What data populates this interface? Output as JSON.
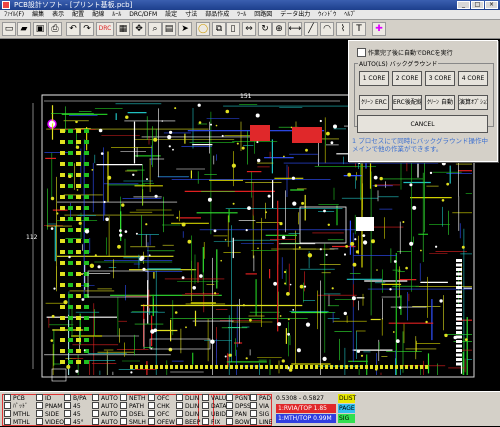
{
  "window": {
    "title": "PCB設計ソフト - [プリント基板.pcb]",
    "minimize": "_",
    "maximize": "□",
    "close": "×"
  },
  "menu": [
    "ﾌｧｲﾙ(F)",
    "編集",
    "表示",
    "配置",
    "配線",
    "ﾙｰﾙ",
    "DRC/DFM",
    "設定",
    "寸法",
    "部品作成",
    "ﾂｰﾙ",
    "回路図",
    "データ出力",
    "ｳｨﾝﾄﾞｳ",
    "ﾍﾙﾌﾟ"
  ],
  "toolbar": {
    "icons": [
      "new-file-icon",
      "open-folder-icon",
      "save-icon",
      "print-icon",
      "undo-icon",
      "redo-icon",
      "drc-icon",
      "grid-icon",
      "pan-icon",
      "zoom-icon",
      "layer-icon",
      "select-icon",
      "circle-icon",
      "copy-icon",
      "paste-icon",
      "move-icon",
      "rotate-icon",
      "pin-icon",
      "measure-icon",
      "line-icon",
      "arc-icon",
      "wire-icon",
      "text-icon",
      "cross-icon"
    ],
    "drc_label": "DRC"
  },
  "board": {
    "dimension_top": "151",
    "dimension_left": "112"
  },
  "dialog": {
    "checkbox_label": "作業完了後に自動でDRCを実行",
    "group_label": "AUTO(LS) バックグラウンド",
    "core_buttons": [
      "1 CORE",
      "2 CORE",
      "3 CORE",
      "4 CORE"
    ],
    "mode_buttons": [
      "ｸﾘｰﾝ ERC",
      "ERC後配線",
      "ｸﾘｰﾝ 自動",
      "演算ｵﾌﾟｼｮﾝ"
    ],
    "cancel_label": "CANCEL",
    "info_text": "1 プロセスにて同時にバックグラウンド操作中\nメインで他の作業ができます。"
  },
  "status": {
    "col1": [
      "PCB",
      "ﾊﾟｯﾄﾞ",
      "MTHL",
      "MTHL"
    ],
    "col2": [
      "ID",
      "PNAM",
      "SIDE",
      "VIDEO"
    ],
    "col3": [
      "B/PA",
      "45",
      "45",
      "45°"
    ],
    "col4": [
      "AUTO",
      "AUTO",
      "AUTO",
      "AUTO"
    ],
    "col5": [
      "NETH",
      "PATH",
      "DSEL",
      "SMLH"
    ],
    "col6": [
      "OFC",
      "CHK",
      "OFC",
      "OFEW"
    ],
    "col7": [
      "DLIN",
      "DLIN",
      "DLIN",
      "BEEP"
    ],
    "col8": [
      "VALUE",
      "DATA",
      "UBID",
      "FIX"
    ],
    "col9": [
      "PGNT",
      "DPSS",
      "PAN",
      "BOWS"
    ],
    "col10": [
      "PAD",
      "VIA",
      "SIG",
      "LINE"
    ],
    "coords": "0.5308 - 0.5827",
    "layer_red": "1:RVIA/TOP 1.85",
    "layer_blue": "1:MTH/TOP 0.99M",
    "swatch_labels": [
      "DLIST",
      "PAGE",
      "SIG"
    ],
    "colors": {
      "red": "#e0282a",
      "blue": "#2f3fe0",
      "yellow": "#e8e800",
      "cyan": "#30c0f0",
      "green": "#30e050"
    }
  }
}
